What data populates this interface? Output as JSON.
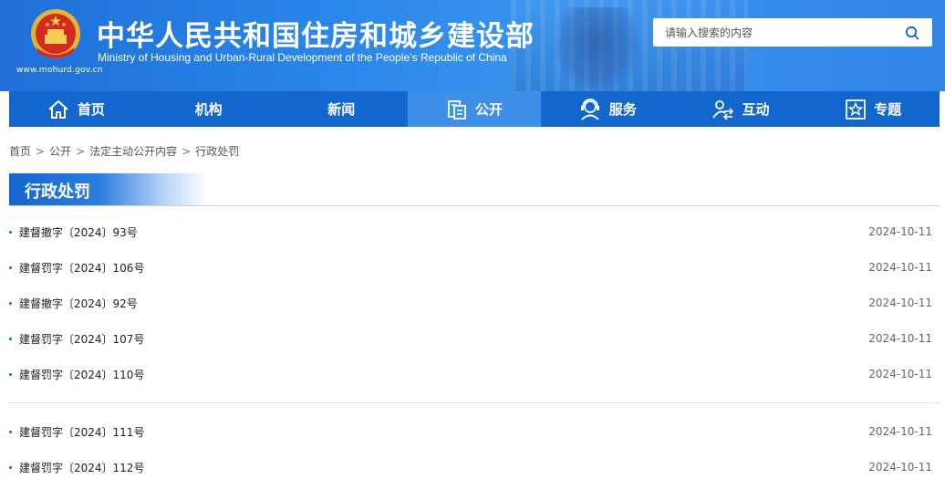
{
  "header": {
    "site_url": "www.mohurd.gov.cn",
    "title": "中华人民共和国住房和城乡建设部",
    "subtitle": "Ministry of Housing and Urban-Rural Development of the People’s Republic of China",
    "search_placeholder": "请输入搜索的内容"
  },
  "nav": {
    "items": [
      {
        "label": "首页",
        "icon": "home-icon"
      },
      {
        "label": "机构",
        "icon": ""
      },
      {
        "label": "新闻",
        "icon": ""
      },
      {
        "label": "公开",
        "icon": "document-icon",
        "active": true
      },
      {
        "label": "服务",
        "icon": "service-icon"
      },
      {
        "label": "互动",
        "icon": "interaction-icon"
      },
      {
        "label": "专题",
        "icon": "star-icon"
      }
    ]
  },
  "breadcrumb": [
    "首页",
    "公开",
    "法定主动公开内容",
    "行政处罚"
  ],
  "section": {
    "title": "行政处罚"
  },
  "list": [
    {
      "title": "建督撤字〔2024〕93号",
      "date": "2024-10-11"
    },
    {
      "title": "建督罚字〔2024〕106号",
      "date": "2024-10-11"
    },
    {
      "title": "建督撤字〔2024〕92号",
      "date": "2024-10-11"
    },
    {
      "title": "建督罚字〔2024〕107号",
      "date": "2024-10-11"
    },
    {
      "title": "建督罚字〔2024〕110号",
      "date": "2024-10-11"
    },
    {
      "title": "建督罚字〔2024〕111号",
      "date": "2024-10-11"
    },
    {
      "title": "建督罚字〔2024〕112号",
      "date": "2024-10-11"
    }
  ],
  "colors": {
    "primary": "#1466cf",
    "active_nav": "#3e8fe8",
    "bullet": "#1466cf"
  }
}
